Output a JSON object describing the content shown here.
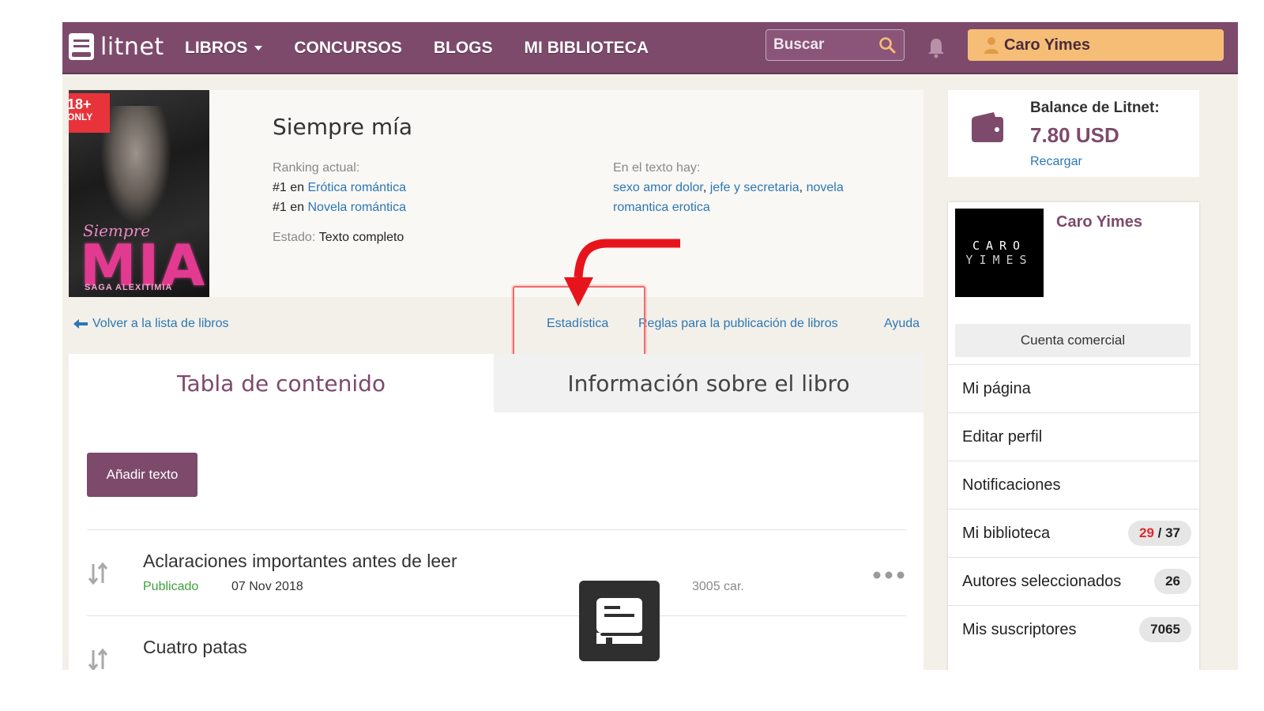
{
  "header": {
    "logo_text": "litnet",
    "nav": [
      {
        "label": "LIBROS"
      },
      {
        "label": "CONCURSOS"
      },
      {
        "label": "BLOGS"
      },
      {
        "label": "MI BIBLIOTECA"
      }
    ],
    "search_placeholder": "Buscar",
    "user_name": "Caro Yimes"
  },
  "book": {
    "cover": {
      "age_badge_top": "18+",
      "age_badge_bottom": "ONLY",
      "script_title": "Siempre",
      "big_title": "MIA",
      "saga": "SAGA ALEXITIMIA"
    },
    "title": "Siempre mía",
    "ranking_label": "Ranking actual:",
    "rank1_prefix": "#1 en ",
    "rank1_link": "Erótica romántica",
    "rank2_prefix": "#1 en ",
    "rank2_link": "Novela romántica",
    "tags_label": "En el texto hay:",
    "tags": [
      "sexo amor dolor",
      "jefe y secretaria",
      "novela romantica erotica"
    ],
    "state_label": "Estado:",
    "state_value": "Texto completo"
  },
  "subnav": {
    "back": "Volver a la lista de libros",
    "stats": "Estadística",
    "rules": "Reglas para la publicación de libros",
    "help": "Ayuda"
  },
  "tabs": {
    "toc": "Tabla de contenido",
    "info": "Información sobre el libro"
  },
  "content": {
    "add_button": "Añadir texto",
    "chapters": [
      {
        "title": "Aclaraciones importantes antes de leer",
        "status": "Publicado",
        "date": "07 Nov 2018",
        "chars": "3005 car."
      },
      {
        "title": "Cuatro patas"
      }
    ]
  },
  "sidebar": {
    "balance_label": "Balance de Litnet:",
    "balance_value": "7.80 USD",
    "recharge": "Recargar",
    "profile_name": "Caro Yimes",
    "avatar_line1": "CARO",
    "avatar_line2": "YIMES",
    "account_type": "Cuenta comercial",
    "menu": [
      {
        "label": "Mi página"
      },
      {
        "label": "Editar perfil"
      },
      {
        "label": "Notificaciones"
      },
      {
        "label": "Mi biblioteca",
        "count_red": "29",
        "count_sep": " / ",
        "count": "37"
      },
      {
        "label": "Autores seleccionados",
        "count": "26"
      },
      {
        "label": "Mis suscriptores",
        "count": "7065"
      }
    ]
  },
  "colors": {
    "brand": "#7d4a6c",
    "accent": "#f6bd76",
    "link": "#2b77b4",
    "published": "#3aa13a",
    "annotation": "#e8141b"
  },
  "icons": [
    "search-icon",
    "bell-icon",
    "user-icon",
    "arrow-left-icon",
    "sort-icon",
    "more-dots-icon",
    "wallet-icon",
    "book-icon"
  ]
}
